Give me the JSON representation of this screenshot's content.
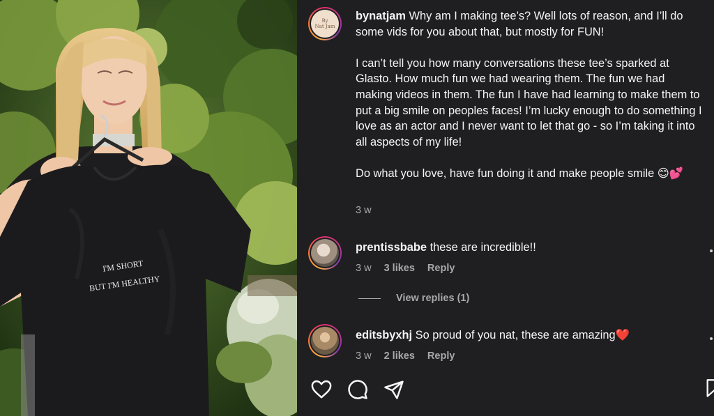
{
  "post": {
    "tee_print_line1": "I'M SHORT",
    "tee_print_line2": "BUT I'M HEALTHY"
  },
  "caption": {
    "username": "bynatjam",
    "avatar_text_line1": "By",
    "avatar_text_line2": "Nat Jam",
    "paragraph_1": "Why am I making tee’s? Well lots of reason, and I’ll do some vids for you about that, but mostly for FUN!",
    "paragraph_2": "I can’t tell you how many conversations these tee’s sparked at Glasto. How much fun we had wearing them. The fun we had making videos in them. The fun I have had learning to make them to put a big smile on peoples faces! I’m lucky enough to do something I love as an actor and I never want to let that go - so I’m taking it into all aspects of my life!",
    "paragraph_3": "Do what you love, have fun doing it and make people smile 😊💕",
    "time": "3 w"
  },
  "comments": [
    {
      "username": "prentissbabe",
      "text": "these are incredible!!",
      "time": "3 w",
      "likes": "3 likes",
      "reply_label": "Reply"
    },
    {
      "username": "editsbyxhj",
      "text": "So proud of you nat, these are amazing❤️",
      "time": "3 w",
      "likes": "2 likes",
      "reply_label": "Reply"
    }
  ],
  "view_replies": "View replies (1)",
  "actions": {
    "like_icon": "heart-icon",
    "comment_icon": "comment-icon",
    "share_icon": "paper-plane-icon",
    "save_icon": "bookmark-icon"
  },
  "colors": {
    "panel_bg": "#1f1f21",
    "text_primary": "#f5f5f5",
    "text_secondary": "#a8a8a8"
  }
}
